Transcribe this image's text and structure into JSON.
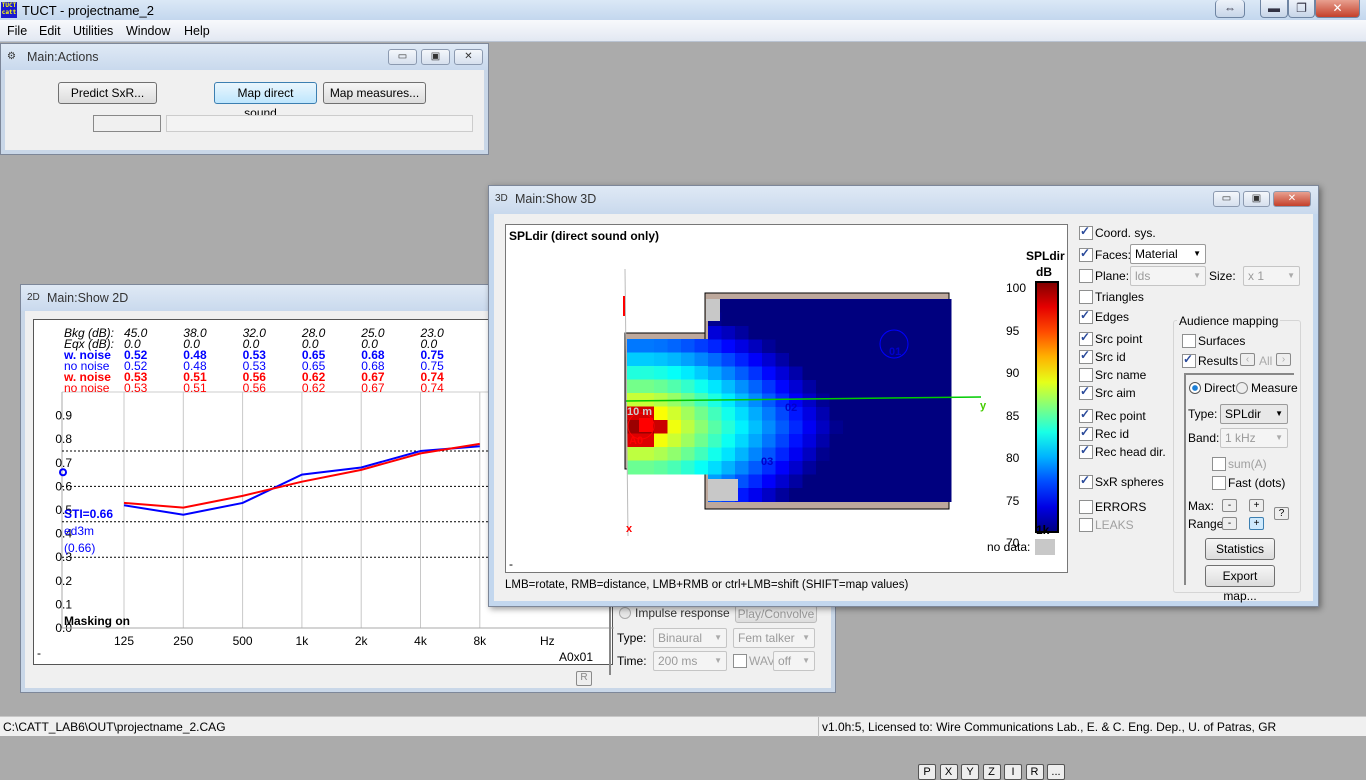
{
  "app": {
    "title": "TUCT - projectname_2",
    "icon_text": "TUCT catt",
    "caption_buttons": [
      "switch-icon",
      "minimize-icon",
      "restore-icon",
      "close-icon"
    ]
  },
  "menu": [
    "File",
    "Edit",
    "Utilities",
    "Window",
    "Help"
  ],
  "status": {
    "path": "C:\\CATT_LAB6\\OUT\\projectname_2.CAG",
    "license": "v1.0h:5, Licensed to: Wire Communications Lab., E. & C. Eng. Dep., U. of Patras, GR"
  },
  "actions": {
    "title": "Main:Actions",
    "predict": "Predict SxR...",
    "map_direct": "Map direct sound...",
    "map_measures": "Map measures..."
  },
  "show2d": {
    "title": "Main:Show 2D",
    "icon": "2D",
    "table": {
      "rows": [
        {
          "label": "Bkg (dB):",
          "values": [
            "45.0",
            "38.0",
            "32.0",
            "28.0",
            "25.0",
            "23.0"
          ],
          "color": "#000000"
        },
        {
          "label": "Eqx (dB):",
          "values": [
            "0.0",
            "0.0",
            "0.0",
            "0.0",
            "0.0",
            "0.0"
          ],
          "color": "#000000"
        },
        {
          "label": "w. noise",
          "values": [
            "0.52",
            "0.48",
            "0.53",
            "0.65",
            "0.68",
            "0.75"
          ],
          "color": "#0000ff",
          "bold": true
        },
        {
          "label": "no noise",
          "values": [
            "0.52",
            "0.48",
            "0.53",
            "0.65",
            "0.68",
            "0.75"
          ],
          "color": "#0000ff"
        },
        {
          "label": "w. noise",
          "values": [
            "0.53",
            "0.51",
            "0.56",
            "0.62",
            "0.67",
            "0.74"
          ],
          "color": "#ff0000",
          "bold": true
        },
        {
          "label": "no noise",
          "values": [
            "0.53",
            "0.51",
            "0.56",
            "0.62",
            "0.67",
            "0.74"
          ],
          "color": "#ff0000"
        }
      ]
    },
    "sti_label": "STI=0.66",
    "sti_name": "ed3m",
    "sti_paren": "(0.66)",
    "masking": "Masking on",
    "receiver": "A0x01",
    "r_button": "R",
    "dash": "-",
    "impulse": "Impulse response",
    "play": "Play/Convolve",
    "type_label": "Type:",
    "type_value": "Binaural",
    "talker": "Fem talker",
    "time_label": "Time:",
    "time_value": "200 ms",
    "wav": "WAV",
    "wav_value": "off"
  },
  "chart_data": {
    "type": "line",
    "xlabel": "Hz",
    "categories": [
      "125",
      "250",
      "500",
      "1k",
      "2k",
      "4k",
      "8k"
    ],
    "ylim": [
      0,
      0.9
    ],
    "yticks": [
      "0.0",
      "0.1",
      "0.2",
      "0.3",
      "0.4",
      "0.5",
      "0.6",
      "0.7",
      "0.8",
      "0.9"
    ],
    "reference_lines": [
      0.3,
      0.45,
      0.6,
      0.75
    ],
    "grid": true,
    "series": [
      {
        "color": "#0000ff",
        "values": [
          0.52,
          0.48,
          0.53,
          0.65,
          0.68,
          0.75,
          0.77
        ]
      },
      {
        "color": "#ff0000",
        "values": [
          0.53,
          0.51,
          0.56,
          0.62,
          0.67,
          0.74,
          0.78
        ]
      }
    ],
    "marker_value": 0.66
  },
  "show3d": {
    "title": "Main:Show 3D",
    "icon": "3D",
    "view_title": "SPLdir (direct sound only)",
    "colorbar": {
      "title": "SPLdir",
      "unit": "dB",
      "ticks": [
        "100",
        "95",
        "90",
        "85",
        "80",
        "75",
        "70"
      ],
      "band": "1k",
      "nodata": "no data:",
      "nodata_color": "#c8c8c8"
    },
    "labels": {
      "src": "A0",
      "r1": "01",
      "r2": "02",
      "r3": "03",
      "y": "y",
      "x": "x",
      "dist": "10 m"
    },
    "hint": "LMB=rotate, RMB=distance, LMB+RMB or ctrl+LMB=shift (SHIFT=map values)",
    "toolbar": [
      "P",
      "X",
      "Y",
      "Z",
      "I",
      "R",
      "..."
    ],
    "options": [
      {
        "label": "Coord. sys.",
        "on": true
      },
      {
        "label": "Faces:",
        "on": true
      },
      {
        "label": "Plane:",
        "on": false
      },
      {
        "label": "Triangles",
        "on": false
      },
      {
        "label": "Edges",
        "on": true
      },
      {
        "label": "Src point",
        "on": true
      },
      {
        "label": "Src id",
        "on": true
      },
      {
        "label": "Src name",
        "on": false
      },
      {
        "label": "Src aim",
        "on": true
      },
      {
        "label": "Rec point",
        "on": true
      },
      {
        "label": "Rec id",
        "on": true
      },
      {
        "label": "Rec head dir.",
        "on": true
      },
      {
        "label": "SxR spheres",
        "on": true
      },
      {
        "label": "ERRORS",
        "on": false
      },
      {
        "label": "LEAKS",
        "on": false,
        "disabled": true
      }
    ],
    "faces_value": "Material",
    "plane_value": "lds",
    "size_label": "Size:",
    "size_value": "x 1",
    "audience": {
      "title": "Audience mapping",
      "surfaces": "Surfaces",
      "results": "Results",
      "all": "All",
      "direct": "Direct",
      "measure": "Measure",
      "type_label": "Type:",
      "type_value": "SPLdir",
      "band_label": "Band:",
      "band_value": "1 kHz",
      "sum": "sum(A)",
      "fast": "Fast (dots)",
      "max": "Max:",
      "range": "Range:",
      "help": "?",
      "statistics": "Statistics",
      "export": "Export map..."
    }
  }
}
